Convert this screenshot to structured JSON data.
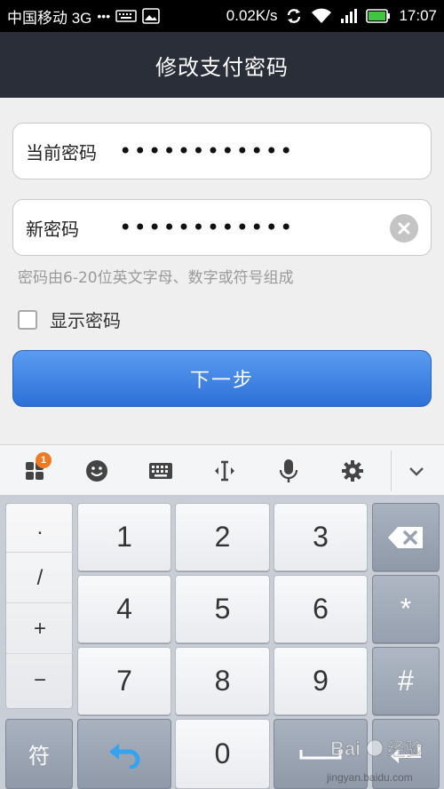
{
  "status_bar": {
    "carrier": "中国移动 3G",
    "dots": "•••",
    "net_speed": "0.02K/s",
    "time": "17:07"
  },
  "header": {
    "title": "修改支付密码"
  },
  "form": {
    "current_password": {
      "label": "当前密码",
      "value": "••••••••••••"
    },
    "new_password": {
      "label": "新密码",
      "value": "••••••••••••"
    },
    "hint": "密码由6-20位英文字母、数字或符号组成",
    "show_password_label": "显示密码",
    "show_password_checked": false,
    "next_button": "下一步"
  },
  "keyboard_toolbar": {
    "badge_count": "1",
    "icons": [
      "apps-icon",
      "emoji-icon",
      "keyboard-icon",
      "cursor-icon",
      "microphone-icon",
      "gear-icon",
      "chevron-down-icon"
    ]
  },
  "keyboard": {
    "symbols": [
      ".",
      "/",
      "+",
      "−"
    ],
    "digits": [
      "1",
      "2",
      "3",
      "4",
      "5",
      "6",
      "7",
      "8",
      "9"
    ],
    "asterisk": "*",
    "hash": "#",
    "symbol_key": "符",
    "zero": "0"
  },
  "watermark": {
    "site": "jingyan.baidu.com",
    "brand": "Baidu 经验"
  },
  "colors": {
    "title_bar": "#2a2e38",
    "accent": "#3a7de0",
    "badge": "#f07a24"
  }
}
